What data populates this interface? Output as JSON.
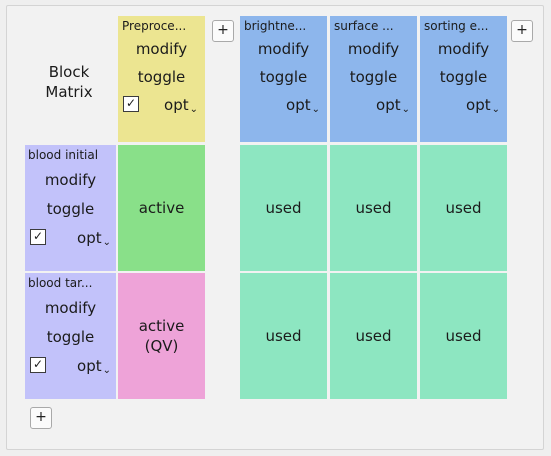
{
  "matrix": {
    "title_line1": "Block",
    "title_line2": "Matrix",
    "add_label": "+",
    "columns": [
      {
        "name": "Preproce...",
        "modify": "modify",
        "toggle": "toggle",
        "opt": "opt",
        "has_checkbox": true,
        "checkbox": "✓",
        "color": "#ece591"
      },
      {
        "name": "brightne...",
        "modify": "modify",
        "toggle": "toggle",
        "opt": "opt",
        "has_checkbox": false,
        "color": "#8db6ec"
      },
      {
        "name": "surface ...",
        "modify": "modify",
        "toggle": "toggle",
        "opt": "opt",
        "has_checkbox": false,
        "color": "#8db6ec"
      },
      {
        "name": "sorting e...",
        "modify": "modify",
        "toggle": "toggle",
        "opt": "opt",
        "has_checkbox": false,
        "color": "#8db6ec"
      }
    ],
    "rows": [
      {
        "name": "blood initial",
        "modify": "modify",
        "toggle": "toggle",
        "opt": "opt",
        "checkbox": "✓",
        "color": "#c2c2fa",
        "cells": [
          {
            "text": "active",
            "color": "#89e089"
          },
          {
            "text": "used",
            "color": "#8de6c1"
          },
          {
            "text": "used",
            "color": "#8de6c1"
          },
          {
            "text": "used",
            "color": "#8de6c1"
          }
        ]
      },
      {
        "name": "blood tar...",
        "modify": "modify",
        "toggle": "toggle",
        "opt": "opt",
        "checkbox": "✓",
        "color": "#c2c2fa",
        "cells": [
          {
            "text": "active\n(QV)",
            "color": "#eea3d8"
          },
          {
            "text": "used",
            "color": "#8de6c1"
          },
          {
            "text": "used",
            "color": "#8de6c1"
          },
          {
            "text": "used",
            "color": "#8de6c1"
          }
        ]
      }
    ]
  }
}
